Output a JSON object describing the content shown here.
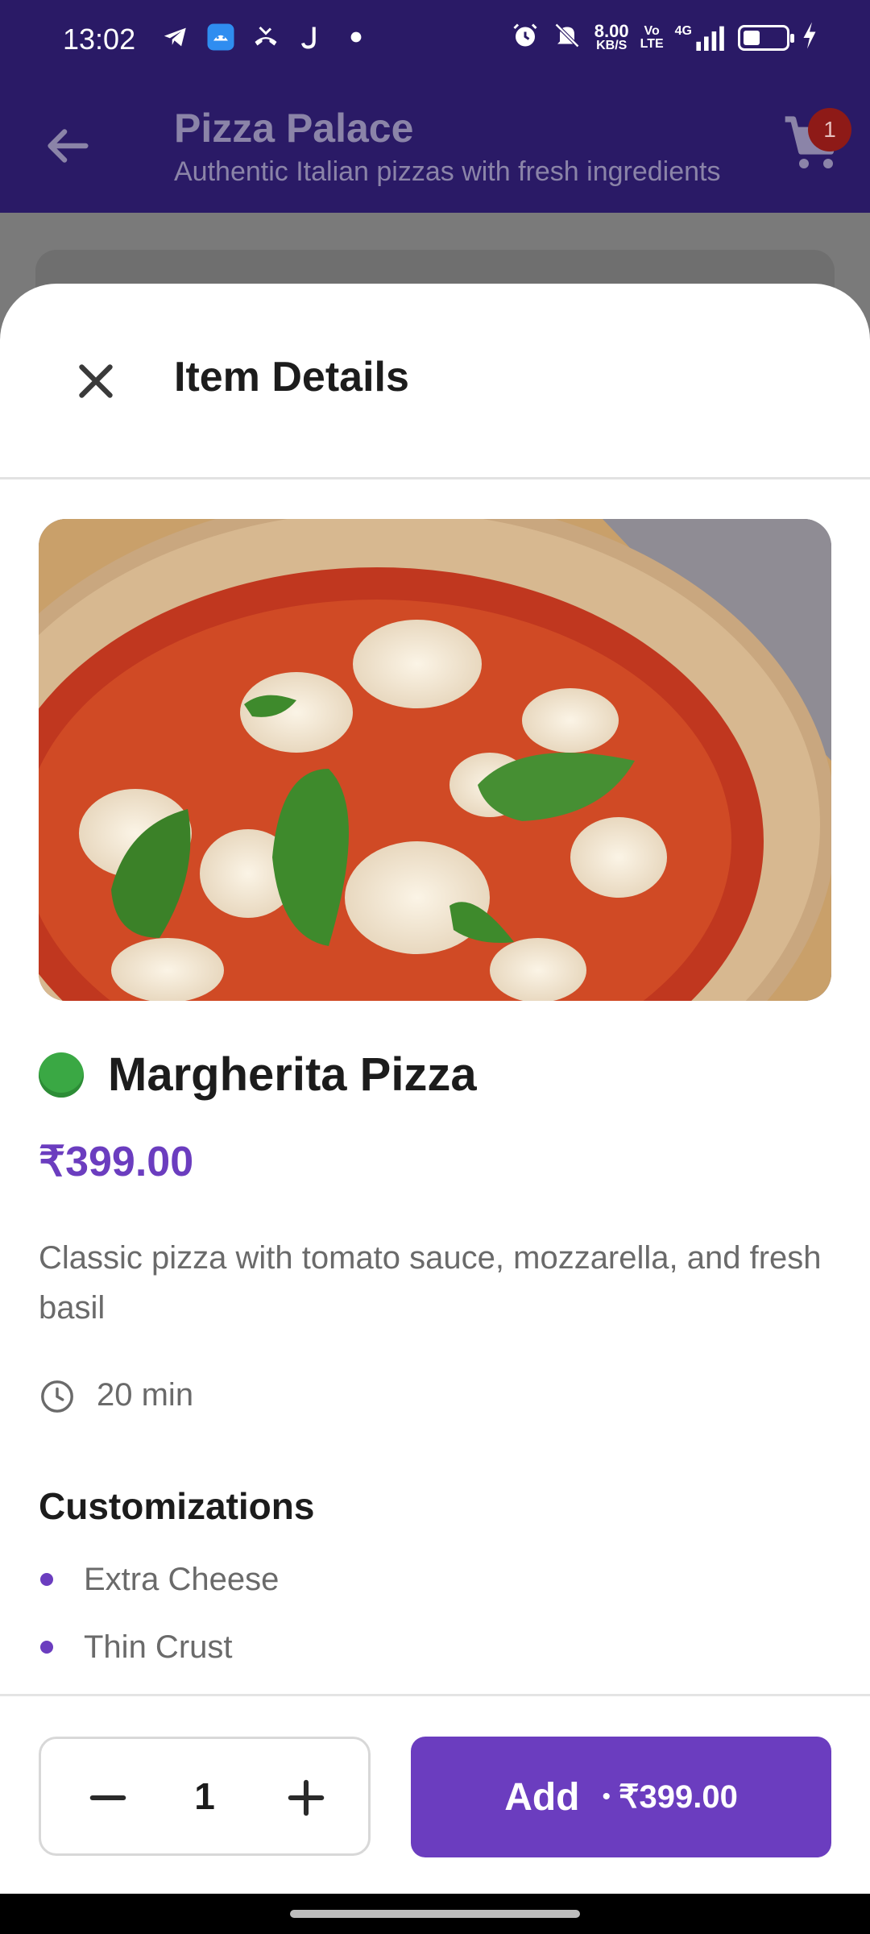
{
  "status_bar": {
    "time": "13:02",
    "speed_value": "8.00",
    "speed_unit": "KB/S",
    "network_label_1": "Vo",
    "network_label_2": "LTE",
    "network_gen": "4G",
    "battery_level": 0.3,
    "left_icons": [
      "telegram-icon",
      "android-icon",
      "missed-call-icon",
      "j-app-icon",
      "dot-icon"
    ],
    "right_icons": [
      "alarm-icon",
      "mute-icon",
      "signal-icon",
      "battery-icon",
      "charging-icon"
    ]
  },
  "app_bar": {
    "title": "Pizza Palace",
    "subtitle": "Authentic Italian pizzas with fresh ingredients",
    "cart_count": "1"
  },
  "sheet": {
    "title": "Item Details"
  },
  "item": {
    "name": "Margherita Pizza",
    "price": "₹399.00",
    "description": "Classic pizza with tomato sauce, mozzarella, and fresh basil",
    "prep_time": "20 min",
    "veg": true
  },
  "customizations": {
    "heading": "Customizations",
    "items": [
      "Extra Cheese",
      "Thin Crust"
    ]
  },
  "cart_action": {
    "quantity": "1",
    "add_label": "Add",
    "separator": "•",
    "add_price": "₹399.00"
  },
  "colors": {
    "primary": "#6b3dbf",
    "app_bar": "#2a1a66",
    "veg": "#3aa844",
    "badge": "#8e1a17"
  }
}
